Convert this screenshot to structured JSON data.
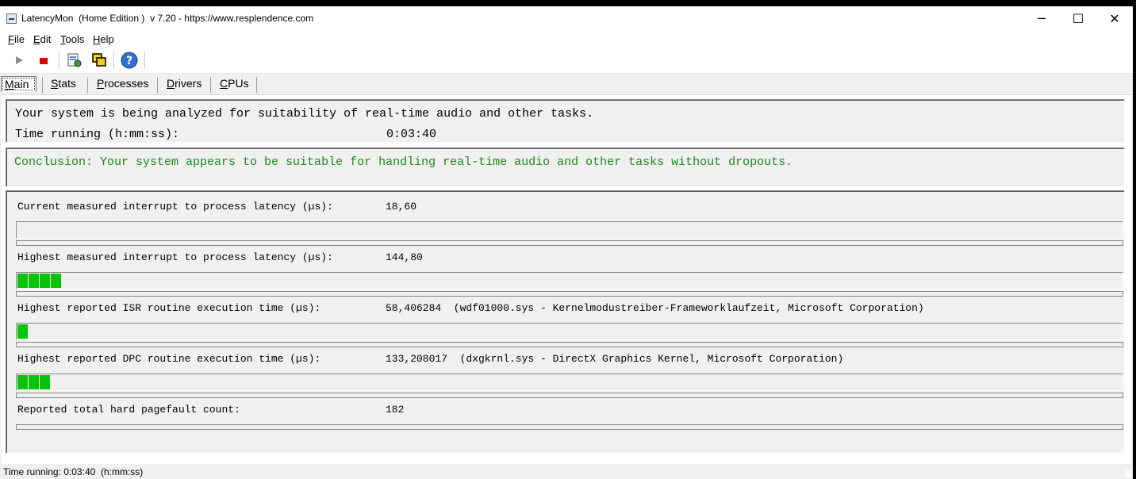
{
  "window": {
    "title": "LatencyMon  (Home Edition )  v 7.20 - https://www.resplendence.com",
    "minimize": "─",
    "maximize": "☐",
    "close": "✕"
  },
  "menu": [
    "File",
    "Edit",
    "Tools",
    "Help"
  ],
  "toolbar": {
    "icons": [
      "play-icon",
      "stop-icon",
      "report-icon",
      "windows-icon",
      "help-icon"
    ]
  },
  "tabs": [
    "Main",
    "Stats",
    "Processes",
    "Drivers",
    "CPUs"
  ],
  "status_panel": {
    "analysis_text": "Your system is being analyzed for suitability of real-time audio and other tasks.",
    "time_label": "Time running (h:mm:ss):",
    "time_value": "0:03:40"
  },
  "conclusion": {
    "text": "Conclusion: Your system appears to be suitable for handling real-time audio and other tasks without dropouts.",
    "color": "#1a8a1a"
  },
  "metrics": [
    {
      "label": "Current measured interrupt to process latency (µs):",
      "value": "18,60",
      "detail": "",
      "bar_segments": 0
    },
    {
      "label": "Highest measured interrupt to process latency (µs):",
      "value": "144,80",
      "detail": "",
      "bar_segments": 4
    },
    {
      "label": "Highest reported ISR routine execution time (µs):",
      "value": "58,406284",
      "detail": "(wdf01000.sys - Kernelmodustreiber-Frameworklaufzeit, Microsoft Corporation)",
      "bar_segments": 1
    },
    {
      "label": "Highest reported DPC routine execution time (µs):",
      "value": "133,208017",
      "detail": "(dxgkrnl.sys - DirectX Graphics Kernel, Microsoft Corporation)",
      "bar_segments": 3
    },
    {
      "label": "Reported total hard pagefault count:",
      "value": "182",
      "detail": "",
      "bar_segments": 0
    }
  ],
  "statusbar": {
    "text": "Time running: 0:03:40  (h:mm:ss)"
  },
  "colors": {
    "bar_fill": "#09c409"
  }
}
